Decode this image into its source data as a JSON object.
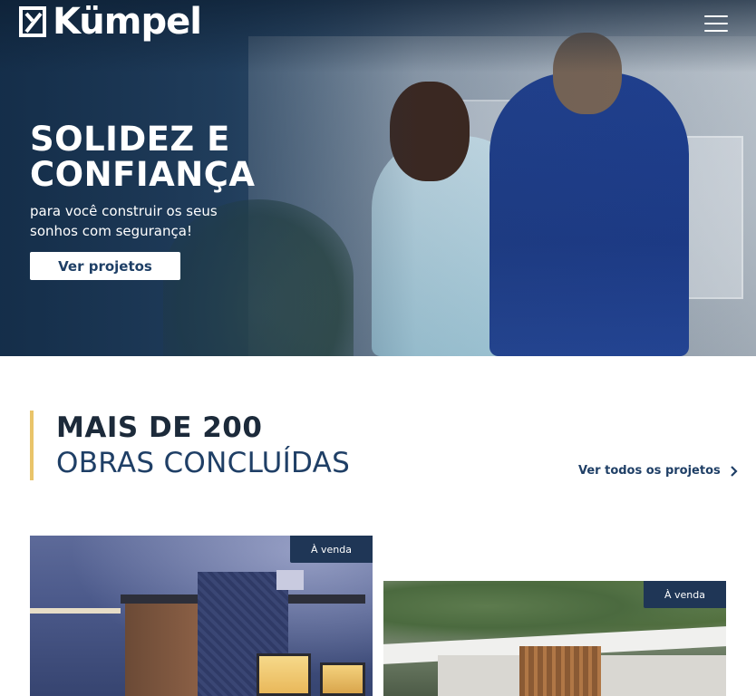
{
  "header": {
    "logo_text": "Kümpel",
    "menu_icon": "hamburger-menu-icon"
  },
  "hero": {
    "title_line1": "SOLIDEZ E",
    "title_line2": "CONFIANÇA",
    "subtitle": "para você construir os seus sonhos com segurança!",
    "cta_label": "Ver projetos"
  },
  "section": {
    "title_bold": "MAIS DE 200",
    "title_light": "OBRAS CONCLUÍDAS",
    "see_all_label": "Ver todos os projetos",
    "accent_color": "#e9c46a",
    "brand_color": "#1f3f66"
  },
  "projects": [
    {
      "badge": "À venda"
    },
    {
      "badge": "À venda"
    }
  ]
}
